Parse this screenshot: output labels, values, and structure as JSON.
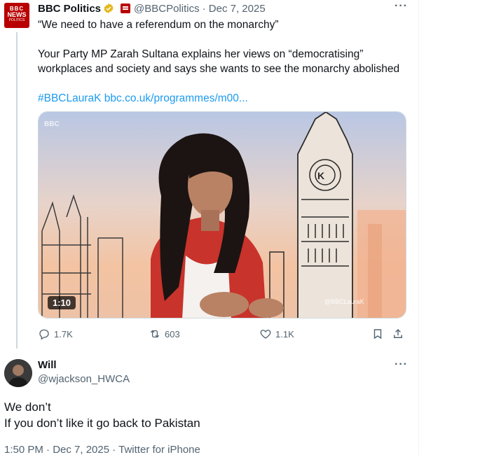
{
  "original_tweet": {
    "avatar": {
      "icon": "bbc-news-politics-logo",
      "line1": "BBC",
      "line2": "NEWS",
      "line3": "POLITICS"
    },
    "display_name": "BBC Politics",
    "verified_icon": "verified-gold-badge-icon",
    "affiliation_icon": "bbc-affiliate-badge-icon",
    "handle": "@BBCPolitics",
    "date": "· Dec 7, 2025",
    "text_line1": "“We need to have a referendum on the monarchy”",
    "text_line2": "Your Party MP Zarah Sultana explains her views on “democratising”",
    "text_line3": "workplaces and society and says she wants to see the monarchy abolished",
    "hashtag": "#BBCLauraK",
    "link": "bbc.co.uk/programmes/m00...",
    "media": {
      "duration": "1:10",
      "watermark": "@BBCLauraK",
      "corner_logo": "BBC"
    },
    "actions": {
      "replies": "1.7K",
      "reposts": "603",
      "likes": "1.1K"
    }
  },
  "reply": {
    "display_name": "Will",
    "handle": "@wjackson_HWCA",
    "text_line1": "We don’t",
    "text_line2": "If you don’t like it go back to Pakistan",
    "meta": "1:50 PM · Dec 7, 2025 · Twitter for iPhone"
  },
  "colors": {
    "accent_blue": "#1d9bf0",
    "muted_text": "#536471",
    "bbc_red": "#b80000",
    "verified_gold": "#e2b719"
  }
}
